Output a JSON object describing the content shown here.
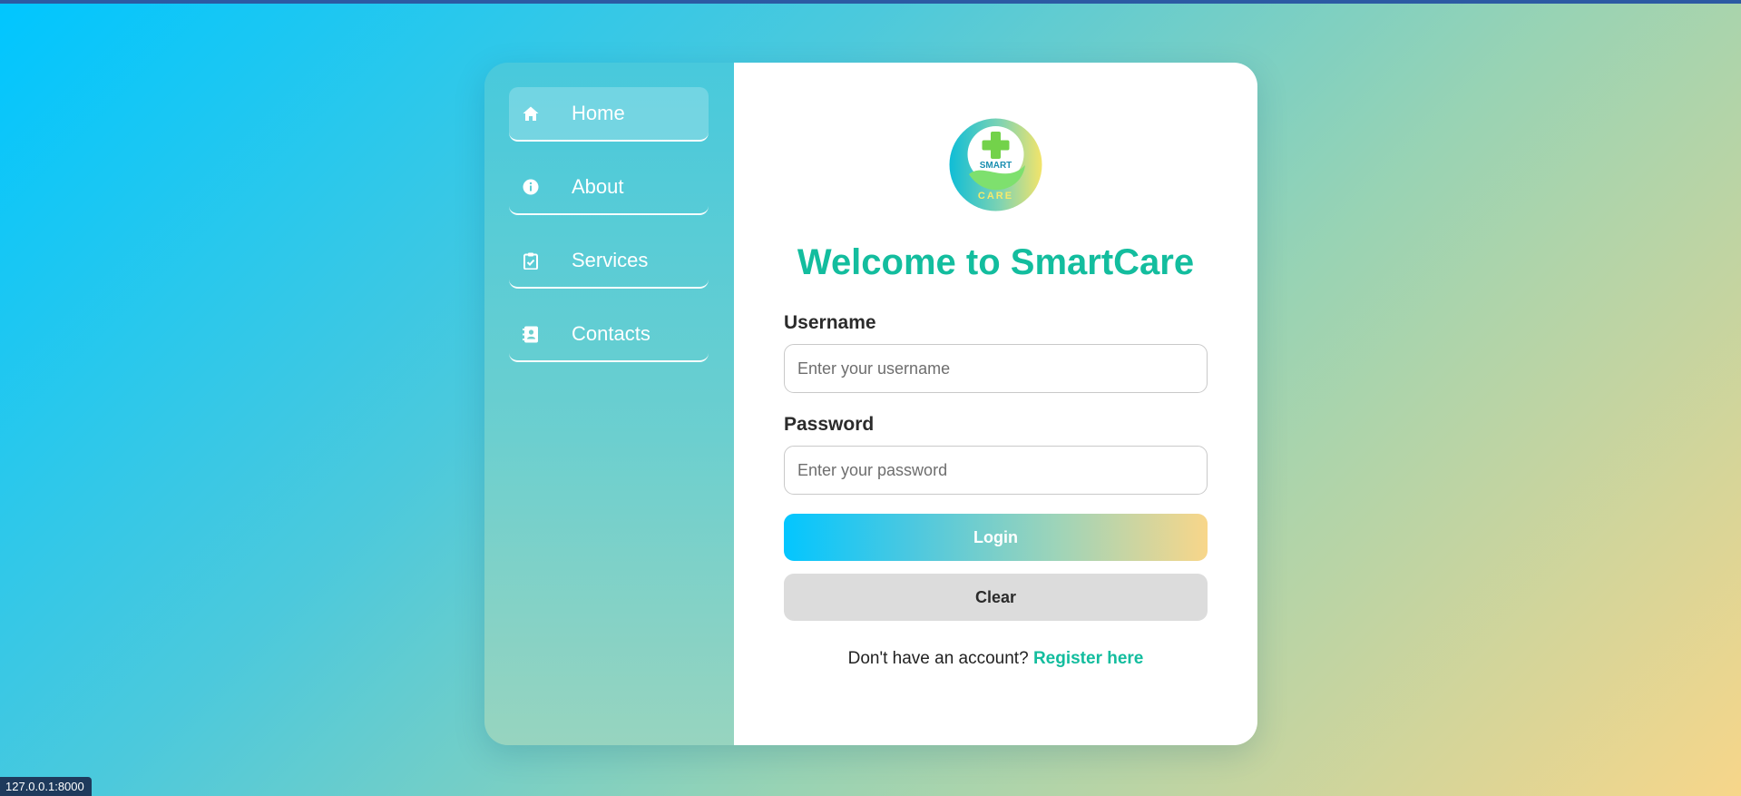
{
  "sidebar": {
    "items": [
      {
        "label": "Home",
        "icon": "home-icon",
        "active": true
      },
      {
        "label": "About",
        "icon": "info-icon",
        "active": false
      },
      {
        "label": "Services",
        "icon": "clipboard-check-icon",
        "active": false
      },
      {
        "label": "Contacts",
        "icon": "contact-book-icon",
        "active": false
      }
    ]
  },
  "logo": {
    "top_text": "SMART",
    "bottom_text": "CARE"
  },
  "main": {
    "title": "Welcome to SmartCare",
    "username": {
      "label": "Username",
      "value": "",
      "placeholder": "Enter your username"
    },
    "password": {
      "label": "Password",
      "value": "",
      "placeholder": "Enter your password"
    },
    "login_label": "Login",
    "clear_label": "Clear",
    "register_prompt": "Don't have an account?",
    "register_link": "Register here"
  },
  "status_bar": {
    "url": "127.0.0.1:8000"
  },
  "colors": {
    "accent": "#13bd9e",
    "gradient_start": "#00c6ff",
    "gradient_end": "#f7d68a",
    "clear_button": "#dcdcdc"
  }
}
